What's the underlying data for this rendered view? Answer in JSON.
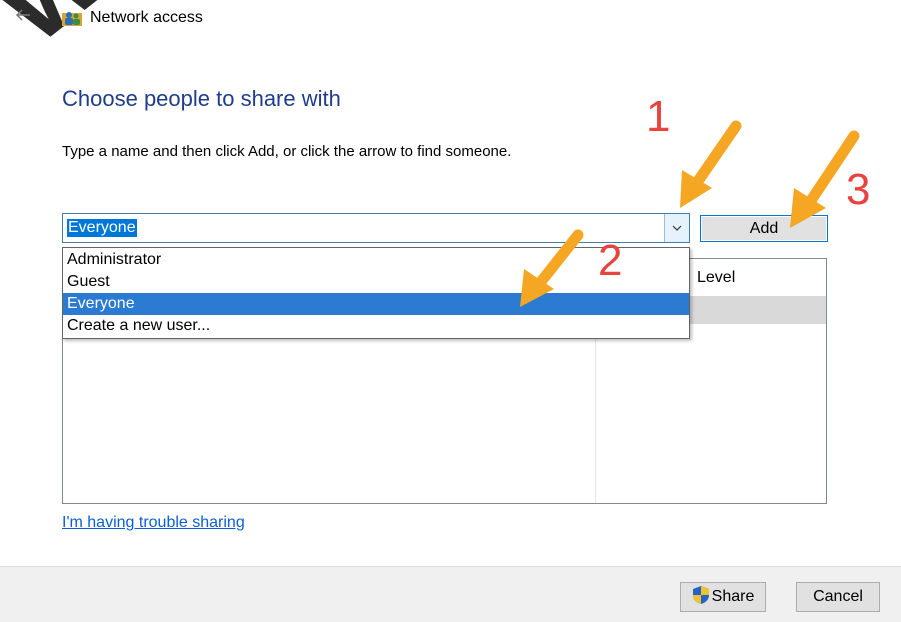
{
  "watermark": "www.",
  "window": {
    "title": "Network access",
    "back_icon": "back-arrow-icon",
    "app_icon": "people-icon"
  },
  "heading": "Choose people to share with",
  "instructions": "Type a name and then click Add, or click the arrow to find someone.",
  "combo": {
    "value": "Everyone",
    "arrow_icon": "chevron-down-icon"
  },
  "add_button": "Add",
  "dropdown": {
    "options": [
      "Administrator",
      "Guest",
      "Everyone",
      "Create a new user..."
    ],
    "selected": "Everyone"
  },
  "table": {
    "column_level": "Level"
  },
  "trouble_link": "I'm having trouble sharing",
  "footer": {
    "share_label": "Share",
    "cancel_label": "Cancel",
    "shield_icon": "uac-shield-icon"
  },
  "annotations": {
    "step1": "1",
    "step2": "2",
    "step3": "3"
  },
  "colors": {
    "heading": "#1f3d8a",
    "selection": "#2a7bd1",
    "link": "#0b5ed7",
    "annotation_number": "#e8433f",
    "annotation_arrow": "#f5a623"
  }
}
